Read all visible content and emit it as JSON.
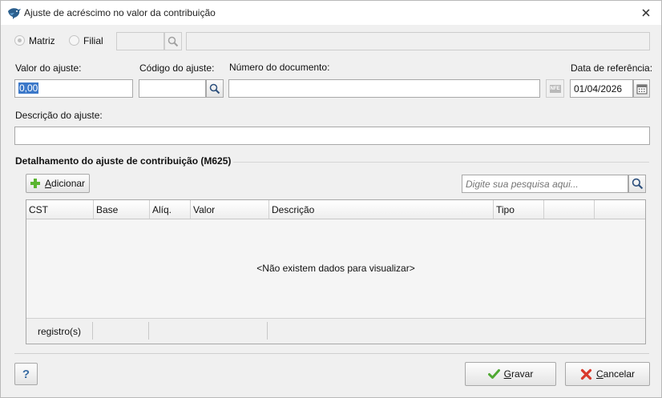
{
  "window": {
    "title": "Ajuste de acréscimo no valor da contribuição",
    "app_icon": "bird-logo-icon",
    "close_icon": "close-icon"
  },
  "filial_row": {
    "matriz_label": "Matriz",
    "filial_label": "Filial",
    "matriz_checked": true,
    "filial_checked": false,
    "code_value": "",
    "name_value": ""
  },
  "fields": {
    "valor_label": "Valor do ajuste:",
    "valor_value": "0,00",
    "codigo_label": "Código do ajuste:",
    "codigo_value": "",
    "numero_label": "Número do documento:",
    "numero_value": "",
    "nfe_badge": "NFE",
    "data_label": "Data de referência:",
    "data_value": "01/04/2026",
    "descricao_label": "Descrição do ajuste:",
    "descricao_value": ""
  },
  "detail": {
    "section_title": "Detalhamento do ajuste de contribuição (M625)",
    "add_button_prefix": "A",
    "add_button_rest": "dicionar",
    "search_placeholder": "Digite sua pesquisa aqui...",
    "columns": [
      "CST",
      "Base",
      "Alíq.",
      "Valor",
      "Descrição",
      "Tipo",
      "",
      ""
    ],
    "empty_message": "<Não existem dados para visualizar>",
    "footer": [
      "registro(s)",
      "",
      "",
      ""
    ]
  },
  "buttons": {
    "help_label": "?",
    "save_prefix": "G",
    "save_rest": "ravar",
    "cancel_prefix": "C",
    "cancel_rest": "ancelar"
  },
  "colors": {
    "accent_selection": "#3b78c9",
    "add_icon_green": "#5bb531",
    "save_check_green": "#4fa832",
    "cancel_x_red": "#d9392b"
  }
}
